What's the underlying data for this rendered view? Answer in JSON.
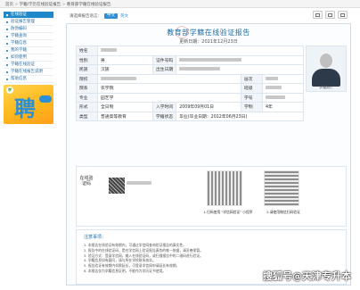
{
  "breadcrumb": {
    "home": "首页",
    "sep1": ">",
    "l1": "学籍/学历在线验证报告",
    "sep2": ">",
    "l2": "教育部学籍在线验证报告"
  },
  "sidebar": {
    "items": [
      {
        "label": "在线验证"
      },
      {
        "label": "验证报告管理"
      },
      {
        "label": "防伪编码"
      },
      {
        "label": "学籍查询"
      },
      {
        "label": "学籍信息"
      },
      {
        "label": "我的学籍"
      },
      {
        "label": "如何使用"
      },
      {
        "label": "学籍在线验证"
      },
      {
        "label": "学籍在线报告说明"
      },
      {
        "label": "帮助信息"
      }
    ],
    "banner": {
      "logo": "学",
      "char": "聘"
    }
  },
  "view": {
    "label": "请选择报告语言：",
    "cn": "中文",
    "en": "英文"
  },
  "report": {
    "title": "教育部学籍在线验证报告",
    "date": "更新日期：2021年12月23日",
    "photo_caption": "学籍照片",
    "rows": [
      {
        "k1": "姓名",
        "v1": "",
        "k2": "",
        "v2": ""
      },
      {
        "k1": "性别",
        "v1": "男",
        "k2": "证件号码",
        "v2": ""
      },
      {
        "k1": "民族",
        "v1": "汉族",
        "k2": "出生日期",
        "v2": ""
      },
      {
        "k1": "院校",
        "v1": "",
        "k2": "层次",
        "v2": ""
      },
      {
        "k1": "院系",
        "v1": "农学院",
        "k2": "班级",
        "v2": ""
      },
      {
        "k1": "专业",
        "v1": "园艺学",
        "k2": "学号",
        "v2": ""
      },
      {
        "k1": "形式",
        "v1": "全日制",
        "k2": "入学时间",
        "v2": "2009年09月01日",
        "k3": "学制",
        "v3": "4年"
      },
      {
        "k1": "类型",
        "v1": "普通高等教育",
        "k2": "学籍状态",
        "v2": "毕业(毕业日期：2012年06月23日)"
      }
    ],
    "verify": {
      "label": "在线验证码",
      "cap1": "1.扫码使用 \"学信网验证\" 小程序",
      "cap2": "2.请使用微信扫码验证"
    },
    "notes": {
      "title": "注意事项：",
      "lines": [
        "1. 本报告在线验证有效期内，可通过学信网查询验证报告的真实性。",
        "2. 报告中的在线验证码，是在学信网上验证报告真伪的唯一依据，请妥善保管。",
        "3. 验证方式：登录学信网，输入在线验证码，或扫描报告中的二维码进行验证。",
        "4. 学籍信息如有疑问，请与所在学校联系核实。",
        "5. 报告验证有效期内如需延长，可登录学信网申请延长有效期。",
        "6. 本报告仅为学籍信息证明，不能作为学历证书使用。"
      ]
    }
  },
  "watermark": "搜狐号@天津专升本",
  "colors": {
    "accent": "#1e88c8",
    "title": "#1e6fa8"
  }
}
